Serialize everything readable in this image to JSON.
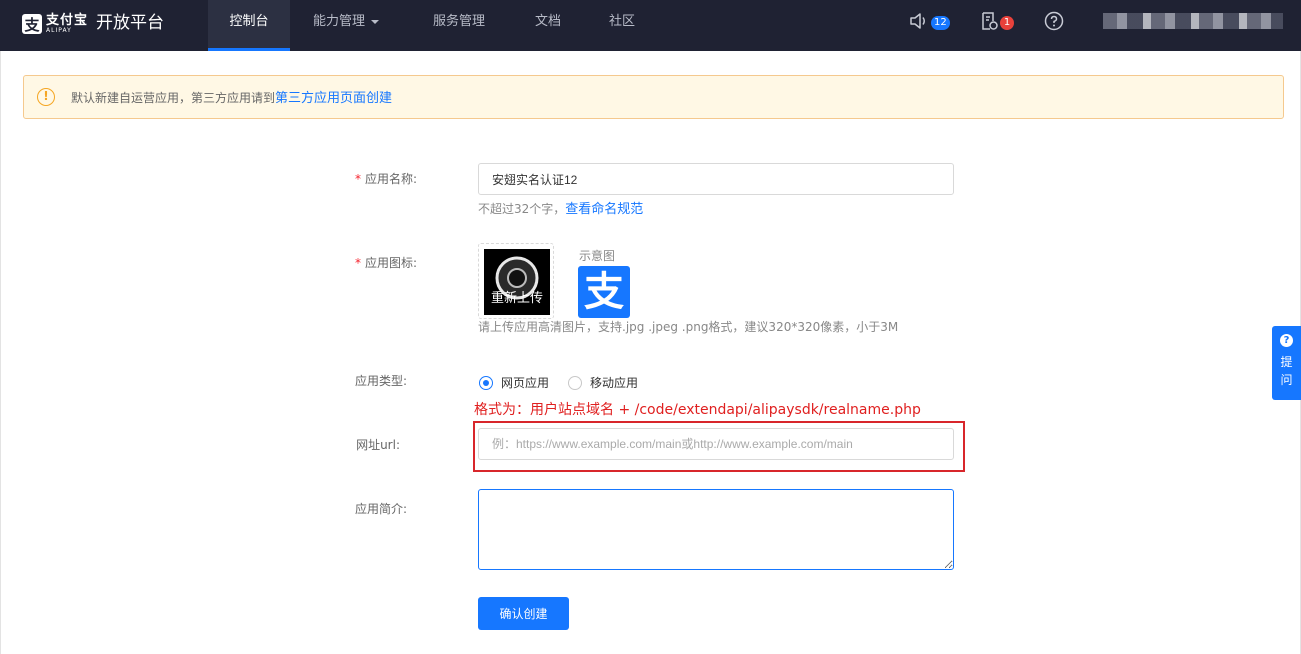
{
  "header": {
    "logo_cn": "支付宝",
    "logo_en": "ALIPAY",
    "platform": "开放平台",
    "nav": [
      {
        "label": "控制台"
      },
      {
        "label": "能力管理"
      },
      {
        "label": "服务管理"
      },
      {
        "label": "文档"
      },
      {
        "label": "社区"
      }
    ],
    "notification_count": "12",
    "task_count": "1",
    "help_icon": "question-circle-icon"
  },
  "alert": {
    "text": "默认新建自运营应用，第三方应用请到",
    "link": "第三方应用页面创建"
  },
  "form": {
    "name": {
      "label": "应用名称:",
      "required_mark": "*",
      "value": "安翅实名认证12",
      "hint": "不超过32个字，",
      "hint_link": "查看命名规范"
    },
    "icon": {
      "label": "应用图标:",
      "required_mark": "*",
      "reupload": "重新上传",
      "sample_label": "示意图",
      "sample_glyph": "支",
      "hint": "请上传应用高清图片，支持.jpg .jpeg .png格式，建议320*320像素，小于3M"
    },
    "type": {
      "label": "应用类型:",
      "options": [
        {
          "label": "网页应用",
          "selected": true
        },
        {
          "label": "移动应用",
          "selected": false
        }
      ]
    },
    "annotation": "格式为：用户站点域名 + /code/extendapi/alipaysdk/realname.php",
    "url": {
      "label": "网址url:",
      "value": "",
      "placeholder": "例：https://www.example.com/main或http://www.example.com/main"
    },
    "intro": {
      "label": "应用简介:",
      "value": ""
    },
    "submit": "确认创建"
  },
  "feedback": {
    "icon": "?",
    "label": "提问"
  },
  "colors": {
    "topbar": "#1f2233",
    "primary": "#1677ff",
    "warning": "#f5a623",
    "danger": "#e02020"
  }
}
